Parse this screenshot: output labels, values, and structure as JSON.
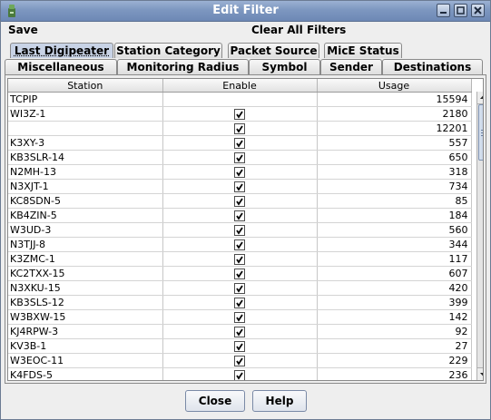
{
  "window": {
    "title": "Edit Filter"
  },
  "menu": {
    "save": "Save",
    "clear_all": "Clear All Filters"
  },
  "tabs_top": [
    "Last Digipeater",
    "Station Category",
    "Packet Source",
    "MicE Status"
  ],
  "tabs_bottom": [
    "Miscellaneous",
    "Monitoring Radius",
    "Symbol",
    "Sender",
    "Destinations"
  ],
  "table": {
    "headers": {
      "station": "Station",
      "enable": "Enable",
      "usage": "Usage"
    },
    "rows": [
      {
        "station": "TCPIP",
        "enabled": null,
        "usage": "15594"
      },
      {
        "station": "WI3Z-1",
        "enabled": true,
        "usage": "2180"
      },
      {
        "station": "",
        "enabled": true,
        "usage": "12201"
      },
      {
        "station": "K3XY-3",
        "enabled": true,
        "usage": "557"
      },
      {
        "station": "KB3SLR-14",
        "enabled": true,
        "usage": "650"
      },
      {
        "station": "N2MH-13",
        "enabled": true,
        "usage": "318"
      },
      {
        "station": "N3XJT-1",
        "enabled": true,
        "usage": "734"
      },
      {
        "station": "KC8SDN-5",
        "enabled": true,
        "usage": "85"
      },
      {
        "station": "KB4ZIN-5",
        "enabled": true,
        "usage": "184"
      },
      {
        "station": "W3UD-3",
        "enabled": true,
        "usage": "560"
      },
      {
        "station": "N3TJJ-8",
        "enabled": true,
        "usage": "344"
      },
      {
        "station": "K3ZMC-1",
        "enabled": true,
        "usage": "117"
      },
      {
        "station": "KC2TXX-15",
        "enabled": true,
        "usage": "607"
      },
      {
        "station": "N3XKU-15",
        "enabled": true,
        "usage": "420"
      },
      {
        "station": "KB3SLS-12",
        "enabled": true,
        "usage": "399"
      },
      {
        "station": "W3BXW-15",
        "enabled": true,
        "usage": "142"
      },
      {
        "station": "KJ4RPW-3",
        "enabled": true,
        "usage": "92"
      },
      {
        "station": "KV3B-1",
        "enabled": true,
        "usage": "27"
      },
      {
        "station": "W3EOC-11",
        "enabled": true,
        "usage": "229"
      },
      {
        "station": "K4FDS-5",
        "enabled": true,
        "usage": "236"
      }
    ]
  },
  "buttons": {
    "close": "Close",
    "help": "Help"
  },
  "colors": {
    "titlebar": "#7d97c0",
    "active_tab": "#c8d3e6",
    "border": "#8a8a8a"
  }
}
